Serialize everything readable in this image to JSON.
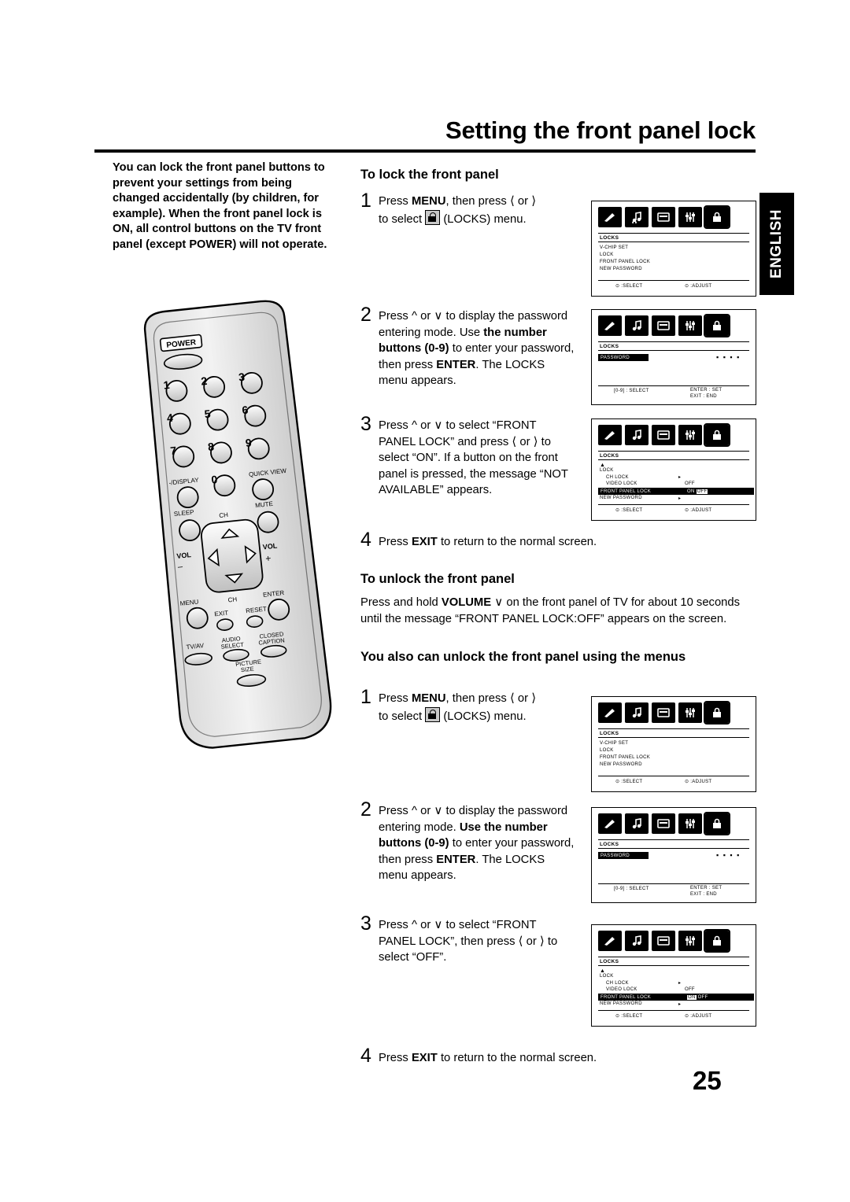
{
  "title": "Setting the front panel lock",
  "english_tab": "ENGLISH",
  "page_number": "25",
  "intro": "You can lock the front panel buttons to prevent your settings from being changed accidentally (by children, for example). When the front panel lock is ON, all control buttons on the TV front panel (except POWER) will not operate.",
  "sections": {
    "lock_heading": "To lock the front panel",
    "unlock_heading": "To unlock the front panel",
    "menus_heading": "You also can unlock the front panel using the menus"
  },
  "lock_steps": [
    {
      "num": "1",
      "line1_a": "Press ",
      "line1_b": "MENU",
      "line1_c": ", then press ",
      "line2_a": "to select ",
      "line2_b": " (LOCKS) menu."
    },
    {
      "num": "2",
      "t1": "Press ",
      "t2": " or ",
      "t3": " to display the password entering mode. Use ",
      "t4": "the number buttons (0-9)",
      "t5": " to enter your password, then press ",
      "t6": "ENTER",
      "t7": ". The LOCKS menu appears."
    },
    {
      "num": "3",
      "t1": "Press ",
      "t2": " or ",
      "t3": " to select “FRONT PANEL LOCK” and press ",
      "t4": " or ",
      "t5": " to select “ON”. If a button on the front panel is pressed, the message “NOT AVAILABLE” appears."
    },
    {
      "num": "4",
      "t1": "Press ",
      "t2": "EXIT",
      "t3": " to return to the normal screen."
    }
  ],
  "unlock_text": {
    "a": "Press and hold ",
    "b": "VOLUME ",
    "c": " on the front panel of TV for about 10 seconds until the message “FRONT PANEL LOCK:OFF” appears on the screen."
  },
  "menu_steps": [
    {
      "num": "1",
      "line1_a": "Press ",
      "line1_b": "MENU",
      "line1_c": ", then press ",
      "line2_a": "to select ",
      "line2_b": " (LOCKS) menu."
    },
    {
      "num": "2",
      "t1": "Press ",
      "t2": " or ",
      "t3": " to display the password entering mode.",
      "t4": "Use the number buttons (0-9)",
      "t5": " to enter your password, then press ",
      "t6": "ENTER",
      "t7": ". The LOCKS menu appears."
    },
    {
      "num": "3",
      "t1": "Press ",
      "t2": " or ",
      "t3": " to select “FRONT PANEL LOCK”, then press ",
      "t4": " or ",
      "t5": " to select “OFF”."
    },
    {
      "num": "4",
      "t1": "Press ",
      "t2": "EXIT",
      "t3": " to return to the normal screen."
    }
  ],
  "osd": {
    "menu_title": "LOCKS",
    "items": [
      "V-CHIP SET",
      "LOCK",
      "FRONT PANEL LOCK",
      "NEW PASSWORD"
    ],
    "footer_select": "⊙ :SELECT",
    "footer_adjust": "⊙ :ADJUST",
    "password_label": "PASSWORD",
    "password_dots": "▪ ▪ ▪ ▪",
    "pwd_foot_left": "[0-9] : SELECT",
    "pwd_foot_right1": "ENTER : SET",
    "pwd_foot_right2": "EXIT : END",
    "lock_submenu": [
      "LOCK",
      "CH LOCK",
      "VIDEO LOCK",
      "FRONT PANEL LOCK",
      "NEW PASSWORD"
    ],
    "video_lock_value": "OFF",
    "fpl_on": "ON",
    "fpl_off": "OFF",
    "icon_names": [
      "picture-icon",
      "audio-icon",
      "feature-icon",
      "setup-icon",
      "lock-icon"
    ]
  },
  "remote": {
    "power": "POWER",
    "num_keys": [
      "1",
      "2",
      "3",
      "4",
      "5",
      "6",
      "7",
      "8",
      "9",
      "0"
    ],
    "display": "-/DISPLAY",
    "quick_view": "QUICK VIEW",
    "sleep": "SLEEP",
    "mute": "MUTE",
    "ch_up": "CH",
    "ch_down": "CH",
    "vol_left": "VOL",
    "vol_right": "VOL",
    "vol_minus": "–",
    "vol_plus": "+",
    "menu": "MENU",
    "enter": "ENTER",
    "exit": "EXIT",
    "reset": "RESET",
    "tvav": "TV/AV",
    "audio_select": "AUDIO SELECT",
    "closed_caption": "CLOSED CAPTION",
    "picture_size": "PICTURE SIZE"
  }
}
